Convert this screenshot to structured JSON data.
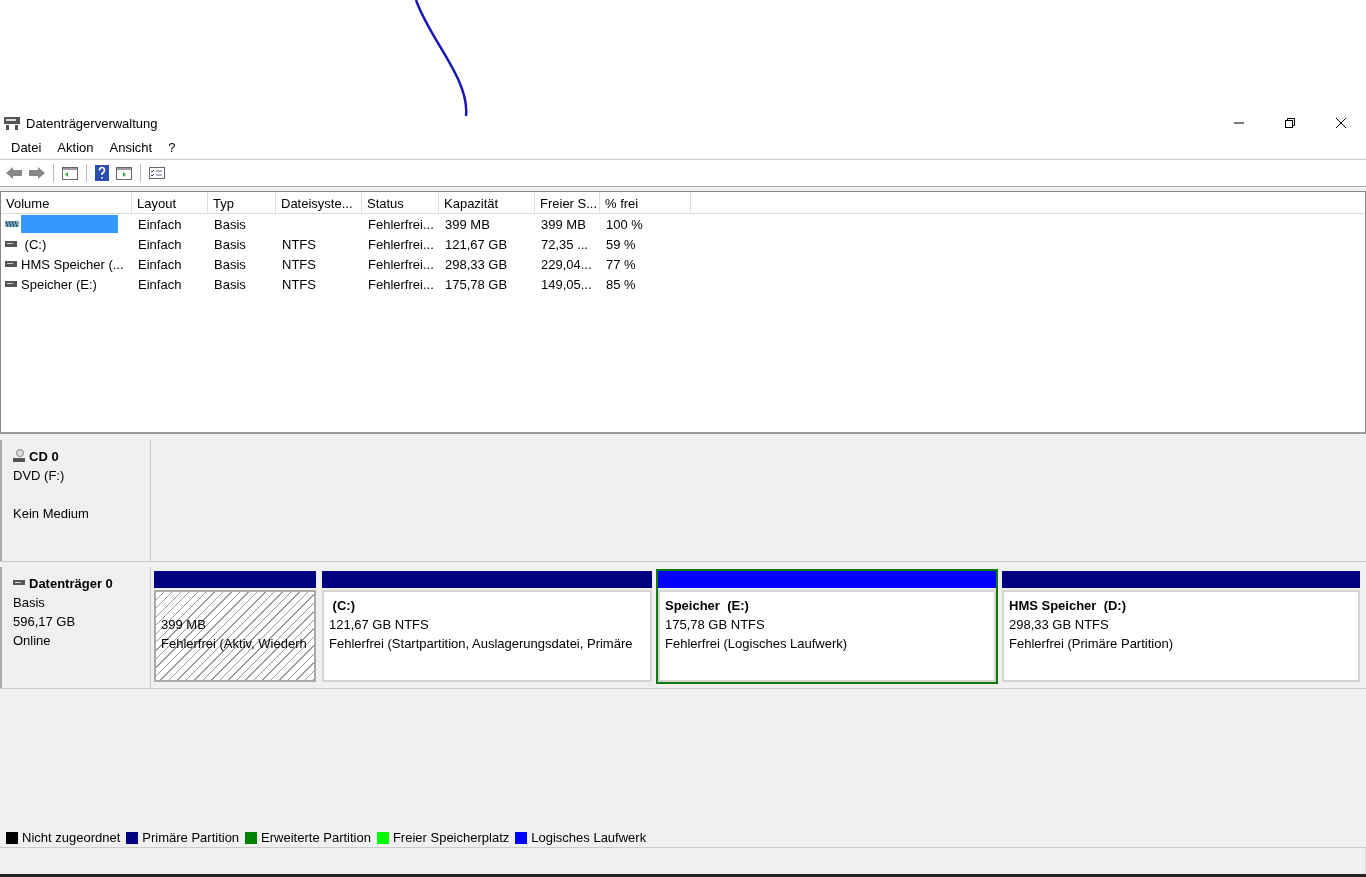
{
  "window": {
    "title": "Datenträgerverwaltung"
  },
  "menu": [
    "Datei",
    "Aktion",
    "Ansicht",
    "?"
  ],
  "table": {
    "columns": [
      "Volume",
      "Layout",
      "Typ",
      "Dateisyste...",
      "Status",
      "Kapazität",
      "Freier S...",
      "% frei"
    ],
    "rows": [
      {
        "selected": true,
        "kind": "striped",
        "cells": [
          "",
          "Einfach",
          "Basis",
          "",
          "Fehlerfrei...",
          "399 MB",
          "399 MB",
          "100 %"
        ]
      },
      {
        "selected": false,
        "kind": "drive",
        "cells": [
          " (C:)",
          "Einfach",
          "Basis",
          "NTFS",
          "Fehlerfrei...",
          "121,67 GB",
          "72,35 ...",
          "59 %"
        ]
      },
      {
        "selected": false,
        "kind": "drive",
        "cells": [
          "HMS Speicher (...",
          "Einfach",
          "Basis",
          "NTFS",
          "Fehlerfrei...",
          "298,33 GB",
          "229,04...",
          "77 %"
        ]
      },
      {
        "selected": false,
        "kind": "drive",
        "cells": [
          "Speicher (E:)",
          "Einfach",
          "Basis",
          "NTFS",
          "Fehlerfrei...",
          "175,78 GB",
          "149,05...",
          "85 %"
        ]
      }
    ]
  },
  "disks": [
    {
      "kind": "cd",
      "name": "CD 0",
      "lines": [
        "DVD (F:)",
        "Kein Medium"
      ]
    },
    {
      "kind": "disk",
      "name": "Datenträger 0",
      "lines": [
        "Basis",
        "596,17 GB",
        "Online"
      ],
      "partitions": [
        {
          "kind": "hatched",
          "color": "#000080",
          "selected": false,
          "lines": [
            "399 MB",
            "Fehlerfrei (Aktiv, Wiederh"
          ]
        },
        {
          "kind": "plain",
          "color": "#000080",
          "selected": false,
          "title": " (C:)",
          "lines": [
            "121,67 GB NTFS",
            "Fehlerfrei (Startpartition, Auslagerungsdatei, Primäre"
          ]
        },
        {
          "kind": "plain",
          "color": "#0000ff",
          "selected": true,
          "title": "Speicher  (E:)",
          "lines": [
            "175,78 GB NTFS",
            "Fehlerfrei (Logisches Laufwerk)"
          ]
        },
        {
          "kind": "plain",
          "color": "#000080",
          "selected": false,
          "title": "HMS Speicher  (D:)",
          "lines": [
            "298,33 GB NTFS",
            "Fehlerfrei (Primäre Partition)"
          ]
        }
      ]
    }
  ],
  "legend": [
    {
      "label": "Nicht zugeordnet",
      "color": "#000000"
    },
    {
      "label": "Primäre Partition",
      "color": "#000080"
    },
    {
      "label": "Erweiterte Partition",
      "color": "#008000"
    },
    {
      "label": "Freier Speicherplatz",
      "color": "#00ff00"
    },
    {
      "label": "Logisches Laufwerk",
      "color": "#0000ff"
    }
  ]
}
